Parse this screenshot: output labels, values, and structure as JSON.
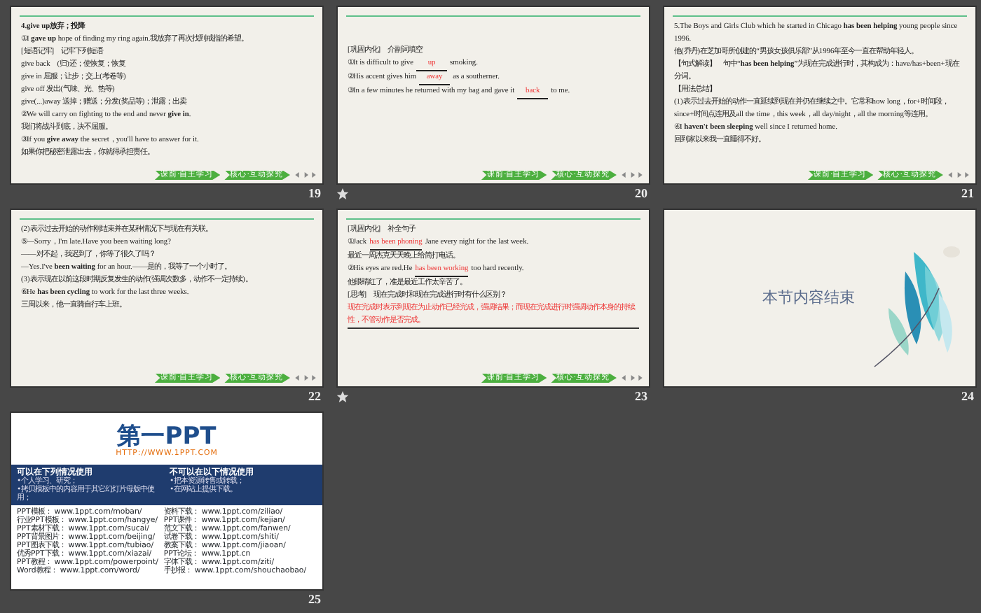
{
  "slides": [
    {
      "number": "19",
      "kind": "text",
      "animated": false,
      "nav_buttons": [
        "课前·自主学习",
        "核心·互动探究"
      ],
      "lines": [
        {
          "kind": "plain",
          "text": "4.give up放弃；投降",
          "bold": true
        },
        {
          "kind": "plain",
          "text": "①I **gave up** hope of finding my ring again.我放弃了再次找到戒指的希望。"
        },
        {
          "kind": "plain",
          "text": "[短语记牢]　记牢下列短语"
        },
        {
          "kind": "plain",
          "text": "give back　(归)还；使恢复；恢复"
        },
        {
          "kind": "plain",
          "text": "give in  屈服；让步；交上(考卷等)"
        },
        {
          "kind": "plain",
          "text": "give off  发出(气味、光、热等)"
        },
        {
          "kind": "plain",
          "text": "give(...)away  送掉；赠送；分发(奖品等)；泄露；出卖"
        },
        {
          "kind": "plain",
          "text": "②We will carry on fighting to the end and never **give in**."
        },
        {
          "kind": "plain",
          "text": "我们将战斗到底，决不屈服。"
        },
        {
          "kind": "plain",
          "text": "③If you **give away** the secret，you'll have to answer for it."
        },
        {
          "kind": "plain",
          "text": "如果你把秘密泄露出去，你就得承担责任。"
        }
      ]
    },
    {
      "number": "20",
      "kind": "text",
      "animated": true,
      "nav_buttons": [
        "课前·自主学习",
        "核心·互动探究"
      ],
      "lines": [
        {
          "kind": "plain",
          "text": "[巩固内化]　介副词填空"
        },
        {
          "kind": "fill",
          "before": "①It is difficult to give",
          "answer": "up",
          "after": "smoking."
        },
        {
          "kind": "fill",
          "before": "②His accent gives him",
          "answer": "away",
          "after": "as a southerner."
        },
        {
          "kind": "fill",
          "before": "③In a few minutes he returned with my bag and gave it",
          "answer": "back",
          "after": "to me."
        }
      ]
    },
    {
      "number": "21",
      "kind": "text",
      "animated": false,
      "nav_buttons": [
        "课前·自主学习",
        "核心·互动探究"
      ],
      "lines": [
        {
          "kind": "plain",
          "text": "5.The Boys and Girls Club which he started in Chicago **has been helping** young people since 1996."
        },
        {
          "kind": "plain",
          "text": "他(乔丹)在芝加哥所创建的“男孩女孩俱乐部”从1996年至今一直在帮助年轻人。"
        },
        {
          "kind": "plain",
          "text": "【句式解读】　句中“**has been helping**”为现在完成进行时，其构成为：have/has+been+现在分词。"
        },
        {
          "kind": "plain",
          "text": "【用法总结】"
        },
        {
          "kind": "plain",
          "text": "(1)表示过去开始的动作一直延续到现在并仍在继续之中。它常和how long，for+时间段，since+时间点连用及all the time，this week，all day/night，all the morning等连用。"
        },
        {
          "kind": "plain",
          "text": "④I **haven't been sleeping** well since I returned home."
        },
        {
          "kind": "plain",
          "text": "回到家以来我一直睡得不好。"
        }
      ]
    },
    {
      "number": "22",
      "kind": "text",
      "animated": false,
      "nav_buttons": [
        "课前·自主学习",
        "核心·互动探究"
      ],
      "lines": [
        {
          "kind": "plain",
          "text": "(2)表示过去开始的动作刚结束并在某种情况下与现在有关联。"
        },
        {
          "kind": "plain",
          "text": "⑤—Sorry，I'm late.Have you been waiting long?"
        },
        {
          "kind": "plain",
          "text": "——对不起，我迟到了，你等了很久了吗？"
        },
        {
          "kind": "plain",
          "text": "—Yes.I've **been waiting** for an hour.——是的，我等了一个小时了。"
        },
        {
          "kind": "plain",
          "text": "(3)表示现在以前这段时期反复发生的动作(强调次数多，动作不一定持续)。"
        },
        {
          "kind": "plain",
          "text": "⑥He **has been cycling** to work for the last three weeks."
        },
        {
          "kind": "plain",
          "text": "三周以来，他一直骑自行车上班。"
        }
      ]
    },
    {
      "number": "23",
      "kind": "text",
      "animated": true,
      "nav_buttons": [
        "课前·自主学习",
        "核心·互动探究"
      ],
      "lines": [
        {
          "kind": "plain",
          "text": "[巩固内化]　补全句子"
        },
        {
          "kind": "fill",
          "before": "①Jack",
          "answer": "has been phoning",
          "after": "Jane every night for the last week."
        },
        {
          "kind": "plain",
          "text": "最近一周杰克天天晚上给简打电话。"
        },
        {
          "kind": "fill",
          "before": "②His eyes are red.He",
          "answer": "has been working",
          "after": "too hard recently."
        },
        {
          "kind": "plain",
          "text": "他眼睛红了，准是最近工作太辛苦了。"
        },
        {
          "kind": "plain",
          "text": "[思考]　现在完成时和现在完成进行时有什么区别？"
        },
        {
          "kind": "answer",
          "text": "现在完成时表示到现在为止动作已经完成，强调结果；而现在完成进行时强调动作本身的持续性，不管动作是否完成。"
        }
      ]
    },
    {
      "number": "24",
      "kind": "end",
      "animated": false,
      "title": "本节内容结束"
    },
    {
      "number": "25",
      "kind": "ad",
      "animated": false,
      "logo": "第一PPT",
      "url": "HTTP://WWW.1PPT.COM",
      "allowed": {
        "heading": "可以在下列情况使用",
        "items": [
          "•个人学习、研究；",
          "•拷贝模板中的内容用于其它幻灯片母版中使用；"
        ]
      },
      "forbidden": {
        "heading": "不可以在以下情况使用",
        "items": [
          "•把本资源转售或转载；",
          "•在网站上提供下载。"
        ]
      },
      "links_left": [
        {
          "label": "PPT模板：",
          "url": "www.1ppt.com/moban/"
        },
        {
          "label": "行业PPT模板：",
          "url": "www.1ppt.com/hangye/"
        },
        {
          "label": "PPT素材下载：",
          "url": "www.1ppt.com/sucai/"
        },
        {
          "label": "PPT背景图片：",
          "url": "www.1ppt.com/beijing/"
        },
        {
          "label": "PPT图表下载：",
          "url": "www.1ppt.com/tubiao/"
        },
        {
          "label": "优秀PPT下载：",
          "url": "www.1ppt.com/xiazai/"
        },
        {
          "label": "PPT教程：",
          "url": "www.1ppt.com/powerpoint/"
        },
        {
          "label": "Word教程：",
          "url": "www.1ppt.com/word/"
        }
      ],
      "links_right": [
        {
          "label": "资料下载：",
          "url": "www.1ppt.com/ziliao/"
        },
        {
          "label": "PPT课件：",
          "url": "www.1ppt.com/kejian/"
        },
        {
          "label": "范文下载：",
          "url": "www.1ppt.com/fanwen/"
        },
        {
          "label": "试卷下载：",
          "url": "www.1ppt.com/shiti/"
        },
        {
          "label": "教案下载：",
          "url": "www.1ppt.com/jiaoan/"
        },
        {
          "label": "PPT论坛：",
          "url": "www.1ppt.cn"
        },
        {
          "label": "字体下载：",
          "url": "www.1ppt.com/ziti/"
        },
        {
          "label": "手抄报：",
          "url": "www.1ppt.com/shouchaobao/"
        }
      ]
    }
  ]
}
